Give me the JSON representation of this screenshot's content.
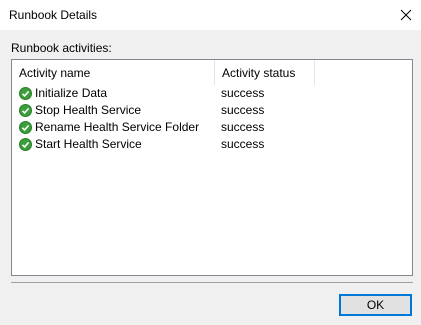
{
  "window": {
    "title": "Runbook Details",
    "close_icon": "close-icon"
  },
  "section_label": "Runbook activities:",
  "table": {
    "columns": [
      "Activity name",
      "Activity status"
    ],
    "rows": [
      {
        "name": "Initialize Data",
        "status": "success",
        "icon": "check-circle-icon"
      },
      {
        "name": "Stop Health Service",
        "status": "success",
        "icon": "check-circle-icon"
      },
      {
        "name": "Rename Health Service Folder",
        "status": "success",
        "icon": "check-circle-icon"
      },
      {
        "name": "Start Health Service",
        "status": "success",
        "icon": "check-circle-icon"
      }
    ]
  },
  "buttons": {
    "ok_label": "OK"
  },
  "colors": {
    "accent": "#0078d7",
    "success": "#3a9e3a"
  }
}
